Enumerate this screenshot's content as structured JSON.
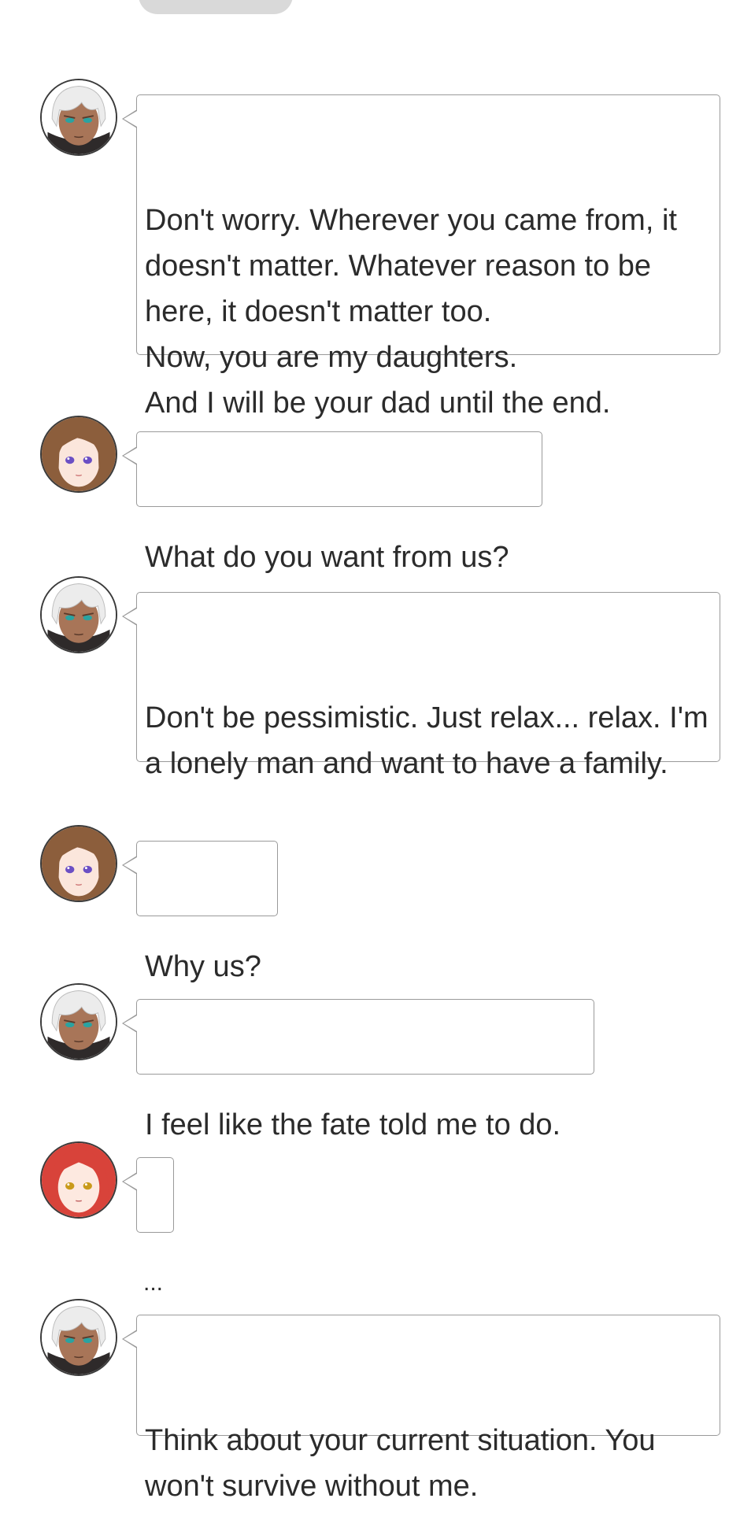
{
  "characters": {
    "dad": {
      "icon": "white-haired-man-avatar",
      "hair": "#f2f2f2",
      "skin": "#a87558",
      "eyes": "#2aa3a1"
    },
    "brown": {
      "icon": "brown-haired-girl-avatar",
      "hair": "#8c5e3c",
      "skin": "#fbe6dc",
      "eyes": "#6b4fc4"
    },
    "red": {
      "icon": "red-haired-girl-avatar",
      "hair": "#d8433a",
      "skin": "#fde9e0",
      "eyes": "#c99a1a"
    }
  },
  "messages": [
    {
      "speaker": "dad",
      "text": "Don't worry. Wherever you came from, it doesn't matter. Whatever reason to be here, it doesn't matter too.\nNow, you are my daughters.\nAnd I will be your dad until the end."
    },
    {
      "speaker": "brown",
      "text": "What do you want from us?"
    },
    {
      "speaker": "dad",
      "text": "Don't be pessimistic. Just relax... relax. I'm a lonely man and want to have a family."
    },
    {
      "speaker": "brown",
      "text": "Why us?"
    },
    {
      "speaker": "dad",
      "text": "I feel like the fate told me to do."
    },
    {
      "speaker": "red",
      "text": "..."
    },
    {
      "speaker": "dad",
      "text": "Think about your current situation. You won't survive without me."
    }
  ]
}
